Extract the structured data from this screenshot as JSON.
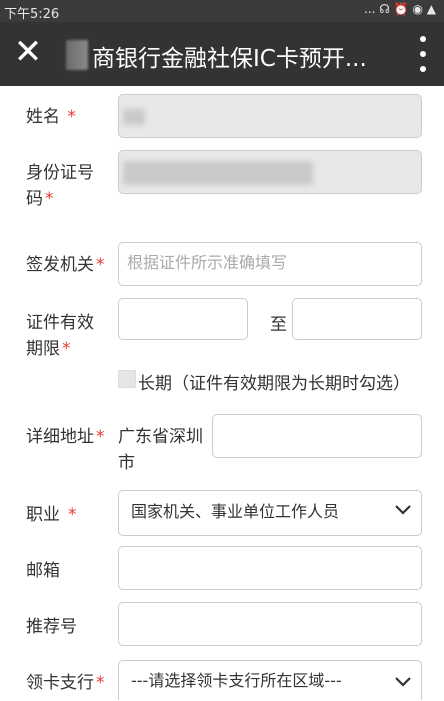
{
  "status_bar": {
    "time": "下午5:26",
    "indicators": "... ☊ ⏰ ◉ ▲"
  },
  "app_bar": {
    "title": "商银行金融社保IC卡预开..."
  },
  "form": {
    "name": {
      "label": "姓名",
      "required_mark": "*"
    },
    "id_number": {
      "label_line1": "身份证号",
      "label_line2": "码",
      "required_mark": "*"
    },
    "issuer": {
      "label": "签发机关",
      "required_mark": "*",
      "placeholder": "根据证件所示准确填写"
    },
    "validity": {
      "label_line1": "证件有效",
      "label_line2": "期限",
      "required_mark": "*",
      "to_text": "至"
    },
    "long_term": {
      "label": "长期（证件有效期限为长期时勾选）",
      "checked": false
    },
    "address": {
      "label": "详细地址",
      "required_mark": "*",
      "prefix_line1": "广东省深圳",
      "prefix_line2": "市"
    },
    "occupation": {
      "label": "职业",
      "required_mark": "*",
      "selected": "国家机关、事业单位工作人员"
    },
    "email": {
      "label": "邮箱"
    },
    "referral": {
      "label": "推荐号"
    },
    "branch": {
      "label": "领卡支行",
      "required_mark": "*",
      "selected": "---请选择领卡支行所在区域---"
    }
  }
}
